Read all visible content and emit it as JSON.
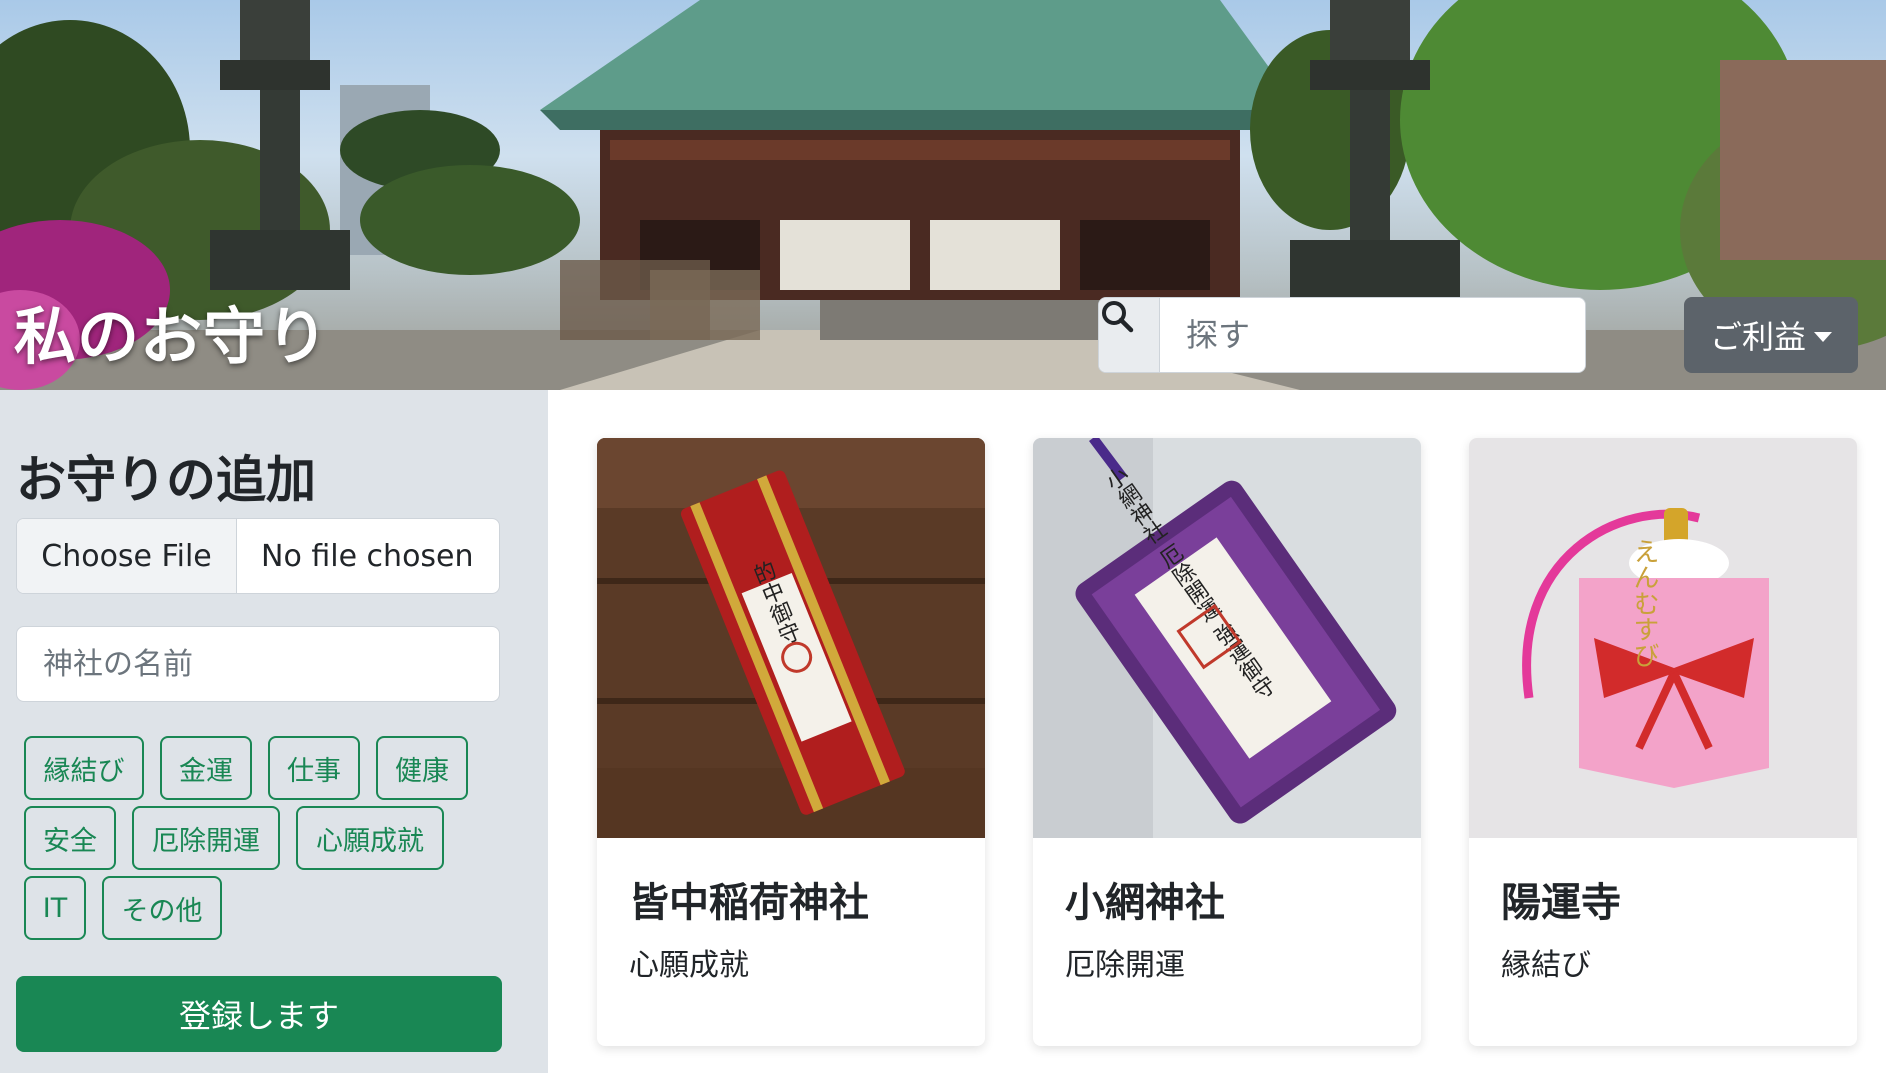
{
  "header": {
    "site_title": "私のお守り",
    "search_placeholder": "探す",
    "benefit_dropdown_label": "ご利益"
  },
  "sidebar": {
    "heading": "お守りの追加",
    "file_button_label": "Choose File",
    "file_status": "No file chosen",
    "shrine_name_placeholder": "神社の名前",
    "tags": [
      "縁結び",
      "金運",
      "仕事",
      "健康",
      "安全",
      "厄除開運",
      "心願成就",
      "IT",
      "その他"
    ],
    "submit_label": "登録します"
  },
  "cards": [
    {
      "title": "皆中稲荷神社",
      "benefit": "心願成就",
      "charm_text": "的中御守"
    },
    {
      "title": "小網神社",
      "benefit": "厄除開運",
      "charm_text": "小網神社 厄除開運 強運御守"
    },
    {
      "title": "陽運寺",
      "benefit": "縁結び",
      "charm_text": "えんむすび"
    }
  ],
  "colors": {
    "accent_green": "#198754",
    "sidebar_bg": "#dee3e8",
    "dropdown_bg": "#5c636a",
    "icons": [
      "search-icon",
      "caret-down-icon"
    ]
  }
}
